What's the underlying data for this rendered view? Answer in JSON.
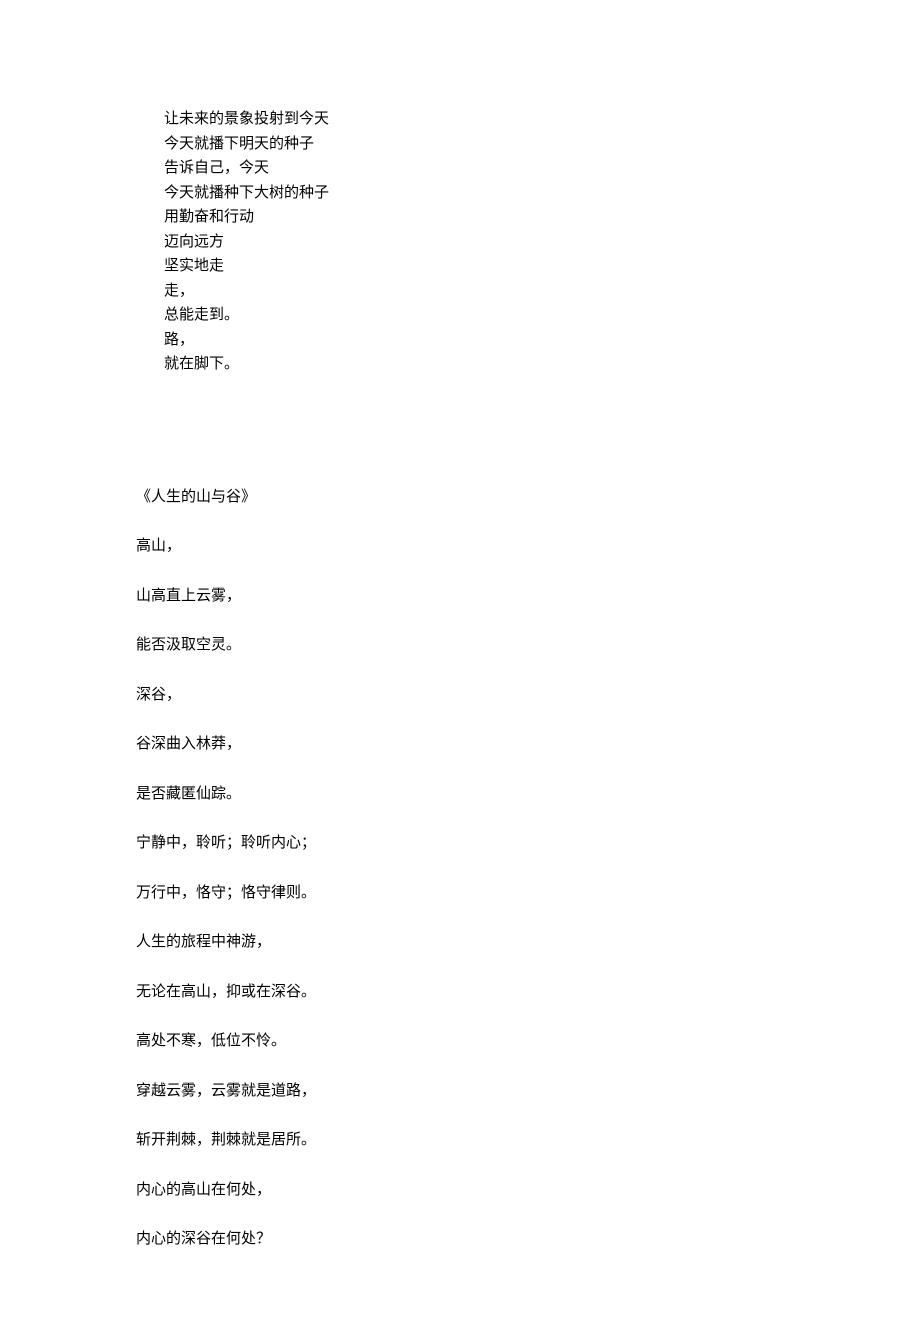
{
  "poem1": {
    "lines": [
      "让未来的景象投射到今天",
      "今天就播下明天的种子",
      "告诉自己，今天",
      "今天就播种下大树的种子",
      "用勤奋和行动",
      "迈向远方",
      "坚实地走",
      "走，",
      "总能走到。",
      "路，",
      "就在脚下。"
    ]
  },
  "poem2": {
    "title": "《人生的山与谷》",
    "lines": [
      "高山，",
      "山高直上云雾，",
      "能否汲取空灵。",
      "深谷，",
      "谷深曲入林莽，",
      "是否藏匿仙踪。",
      "宁静中，聆听；聆听内心；",
      "万行中，恪守；恪守律则。",
      "人生的旅程中神游，",
      "无论在高山，抑或在深谷。",
      "高处不寒，低位不怜。",
      "穿越云雾，云雾就是道路，",
      "斩开荆棘，荆棘就是居所。",
      "内心的高山在何处，",
      "内心的深谷在何处？"
    ]
  }
}
